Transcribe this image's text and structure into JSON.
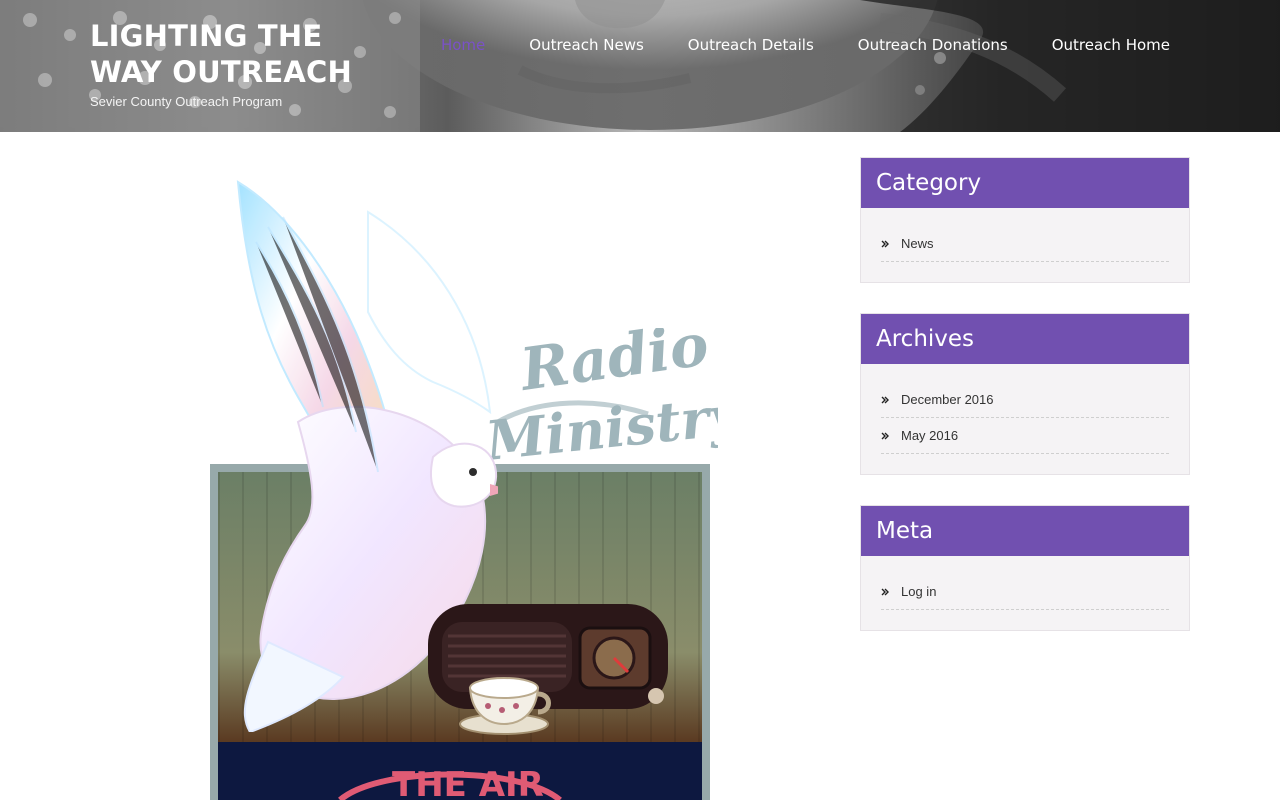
{
  "site": {
    "title": "LIGHTING THE WAY OUTREACH",
    "tagline": "Sevier County Outreach Program"
  },
  "nav": {
    "items": [
      {
        "label": "Home",
        "active": true
      },
      {
        "label": "Outreach News",
        "active": false
      },
      {
        "label": "Outreach Details",
        "active": false
      },
      {
        "label": "Outreach Donations",
        "active": false
      },
      {
        "label": "Outreach Home",
        "active": false
      }
    ]
  },
  "featured_image": {
    "lettering": "Radio Ministry",
    "banner_text": "THE AIR"
  },
  "sidebar": {
    "widgets": [
      {
        "title": "Category",
        "items": [
          "News"
        ]
      },
      {
        "title": "Archives",
        "items": [
          "December 2016",
          "May 2016"
        ]
      },
      {
        "title": "Meta",
        "items": [
          "Log in"
        ]
      }
    ]
  },
  "colors": {
    "accent": "#7150b0",
    "nav_active": "#7a52c7",
    "widget_bg": "#f5f3f5",
    "header_text": "#ffffff"
  }
}
